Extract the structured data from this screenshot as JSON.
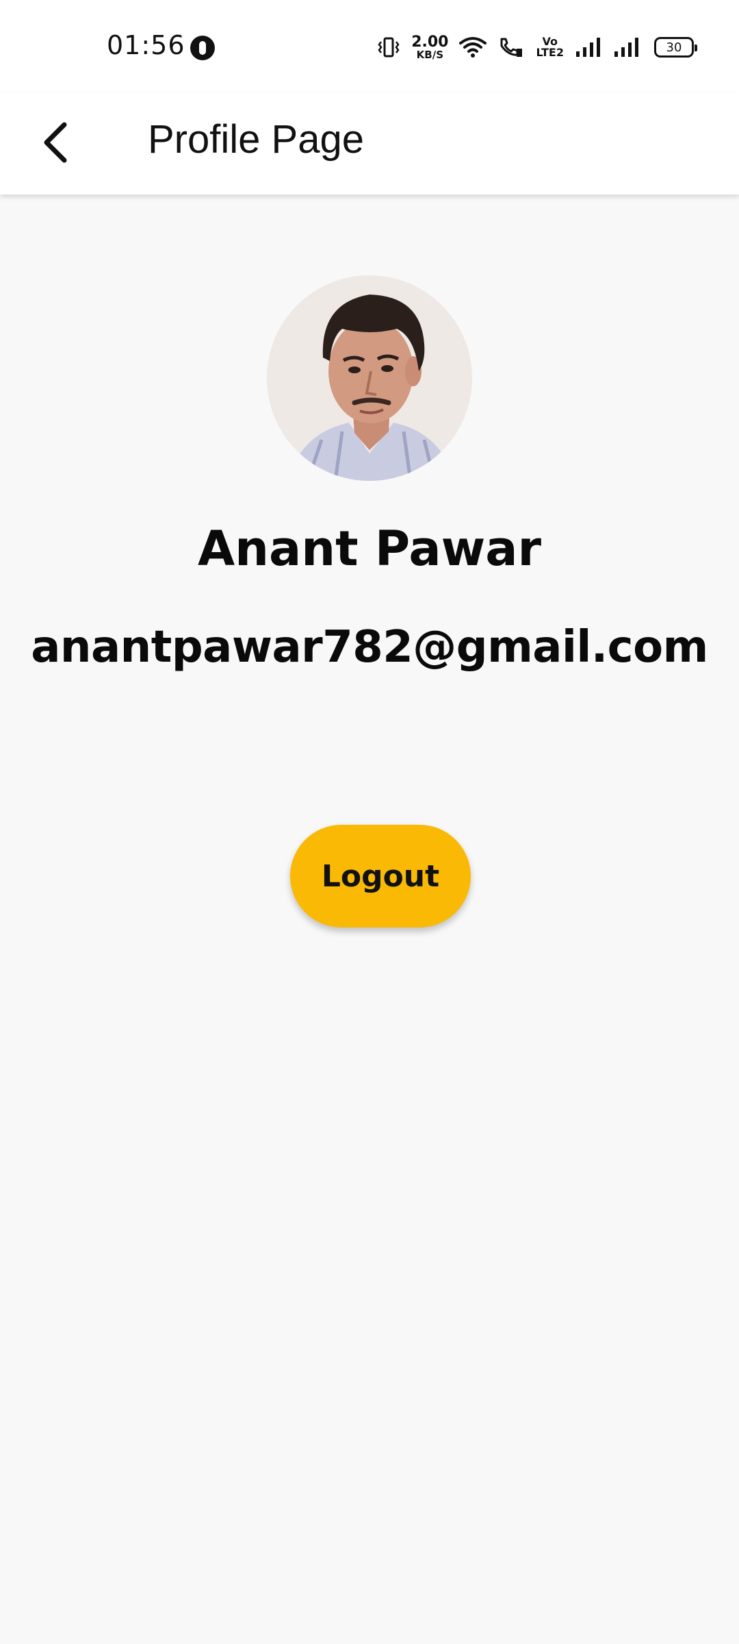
{
  "status_bar": {
    "time": "01:56",
    "net_speed_value": "2.00",
    "net_speed_unit": "KB/S",
    "volte_top": "Vo",
    "volte_bottom": "LTE2",
    "battery_level": "30"
  },
  "app_bar": {
    "title": "Profile Page"
  },
  "profile": {
    "name": "Anant Pawar",
    "email": "anantpawar782@gmail.com"
  },
  "actions": {
    "logout_label": "Logout"
  },
  "colors": {
    "accent": "#f9b904",
    "background": "#f8f8f8",
    "app_bar": "#ffffff"
  }
}
